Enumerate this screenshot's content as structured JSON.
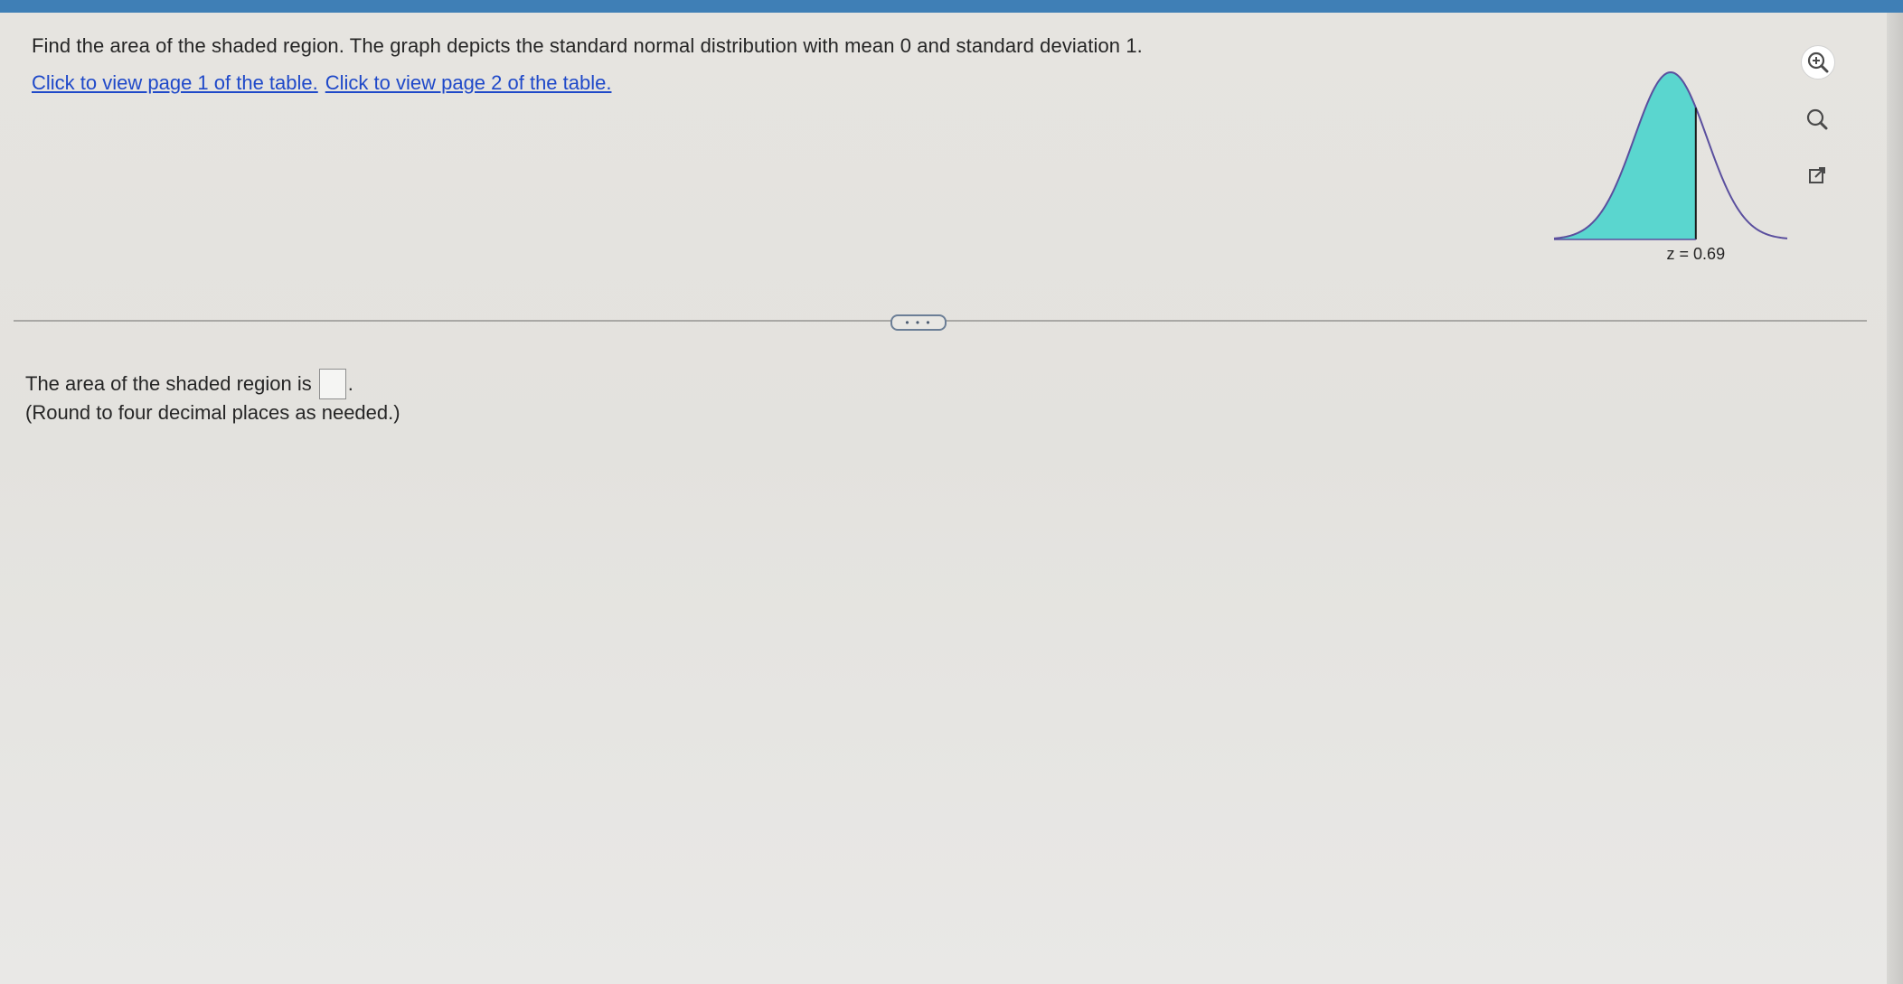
{
  "question": {
    "text": "Find the area of the shaded region. The graph depicts the standard normal distribution with mean 0 and standard deviation 1.",
    "link_page1": "Click to view page 1 of the table.",
    "link_page2": "Click to view page 2 of the table."
  },
  "graph": {
    "z_value": 0.69,
    "z_label": "z = 0.69",
    "shaded_side": "left",
    "fill_color": "#5ad6cf",
    "curve_color": "#5a4f9e"
  },
  "tools": {
    "zoom_in": "zoom-in-icon",
    "zoom_out": "zoom-out-icon",
    "popout": "popout-icon"
  },
  "divider": {
    "more_label": "• • •"
  },
  "answer": {
    "prompt": "The area of the shaded region is",
    "suffix": ".",
    "value": "",
    "instructions": "(Round to four decimal places as needed.)"
  }
}
